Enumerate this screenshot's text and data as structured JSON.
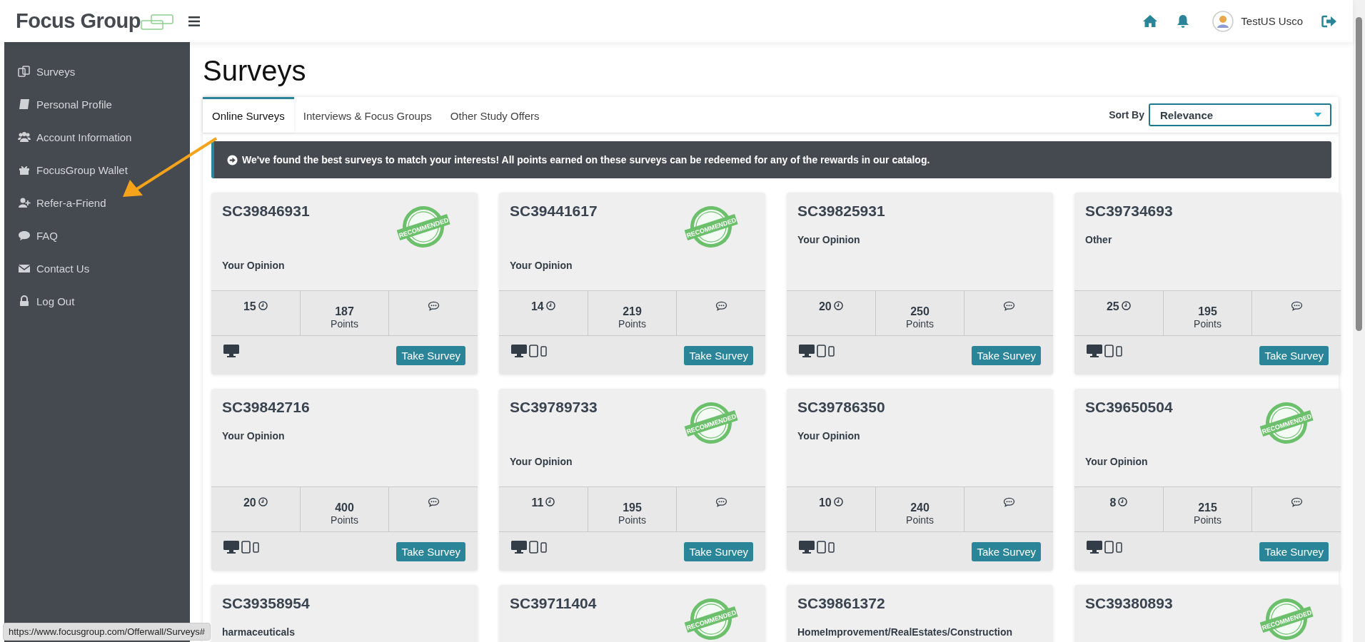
{
  "header": {
    "logo": "Focus Group",
    "user_name": "TestUS Usco"
  },
  "sidebar": {
    "items": [
      {
        "label": "Surveys"
      },
      {
        "label": "Personal Profile"
      },
      {
        "label": "Account Information"
      },
      {
        "label": "FocusGroup Wallet"
      },
      {
        "label": "Refer-a-Friend"
      },
      {
        "label": "FAQ"
      },
      {
        "label": "Contact Us"
      },
      {
        "label": "Log Out"
      }
    ]
  },
  "page_title": "Surveys",
  "tabs": [
    {
      "label": "Online Surveys",
      "selected": true
    },
    {
      "label": "Interviews & Focus Groups",
      "selected": false
    },
    {
      "label": "Other Study Offers",
      "selected": false
    }
  ],
  "sort": {
    "label": "Sort By",
    "value": "Relevance"
  },
  "banner": "We've found the best surveys to match your interests! All points earned on these surveys can be redeemed for any of the rewards in our catalog.",
  "cards": [
    {
      "id": "SC39846931",
      "badge": "RECOMMENDED",
      "category": "Your Opinion",
      "minutes": "15",
      "points": "187",
      "points_label": "Points",
      "devices": [
        {
          "kind": "desktop"
        }
      ],
      "button": "Take Survey"
    },
    {
      "id": "SC39441617",
      "badge": "RECOMMENDED",
      "category": "Your Opinion",
      "minutes": "14",
      "points": "219",
      "points_label": "Points",
      "devices": [
        {
          "kind": "desktop"
        },
        {
          "kind": "tablet"
        },
        {
          "kind": "phone"
        }
      ],
      "button": "Take Survey"
    },
    {
      "id": "SC39825931",
      "category": "Your Opinion",
      "minutes": "20",
      "points": "250",
      "points_label": "Points",
      "devices": [
        {
          "kind": "desktop"
        },
        {
          "kind": "tablet"
        },
        {
          "kind": "phone"
        }
      ],
      "button": "Take Survey"
    },
    {
      "id": "SC39734693",
      "category": "Other",
      "minutes": "25",
      "points": "195",
      "points_label": "Points",
      "devices": [
        {
          "kind": "desktop"
        },
        {
          "kind": "tablet"
        },
        {
          "kind": "phone"
        }
      ],
      "button": "Take Survey"
    },
    {
      "id": "SC39842716",
      "category": "Your Opinion",
      "minutes": "20",
      "points": "400",
      "points_label": "Points",
      "devices": [
        {
          "kind": "desktop"
        },
        {
          "kind": "tablet"
        },
        {
          "kind": "phone"
        }
      ],
      "button": "Take Survey"
    },
    {
      "id": "SC39789733",
      "badge": "RECOMMENDED",
      "category": "Your Opinion",
      "minutes": "11",
      "points": "195",
      "points_label": "Points",
      "devices": [
        {
          "kind": "desktop"
        },
        {
          "kind": "tablet"
        },
        {
          "kind": "phone"
        }
      ],
      "button": "Take Survey"
    },
    {
      "id": "SC39786350",
      "category": "Your Opinion",
      "minutes": "10",
      "points": "240",
      "points_label": "Points",
      "devices": [
        {
          "kind": "desktop"
        },
        {
          "kind": "tablet"
        },
        {
          "kind": "phone"
        }
      ],
      "button": "Take Survey"
    },
    {
      "id": "SC39650504",
      "badge": "RECOMMENDED",
      "category": "Your Opinion",
      "minutes": "8",
      "points": "215",
      "points_label": "Points",
      "devices": [
        {
          "kind": "desktop"
        },
        {
          "kind": "tablet"
        },
        {
          "kind": "phone"
        }
      ],
      "button": "Take Survey"
    },
    {
      "id": "SC39358954",
      "category": "harmaceuticals"
    },
    {
      "id": "SC39711404",
      "badge": "RECOMMENDED"
    },
    {
      "id": "SC39861372",
      "category": "HomeImprovement/RealEstates/Construction"
    },
    {
      "id": "SC39380893",
      "badge": "RECOMMENDED"
    }
  ],
  "status_url": "https://www.focusgroup.com/Offerwall/Surveys#"
}
